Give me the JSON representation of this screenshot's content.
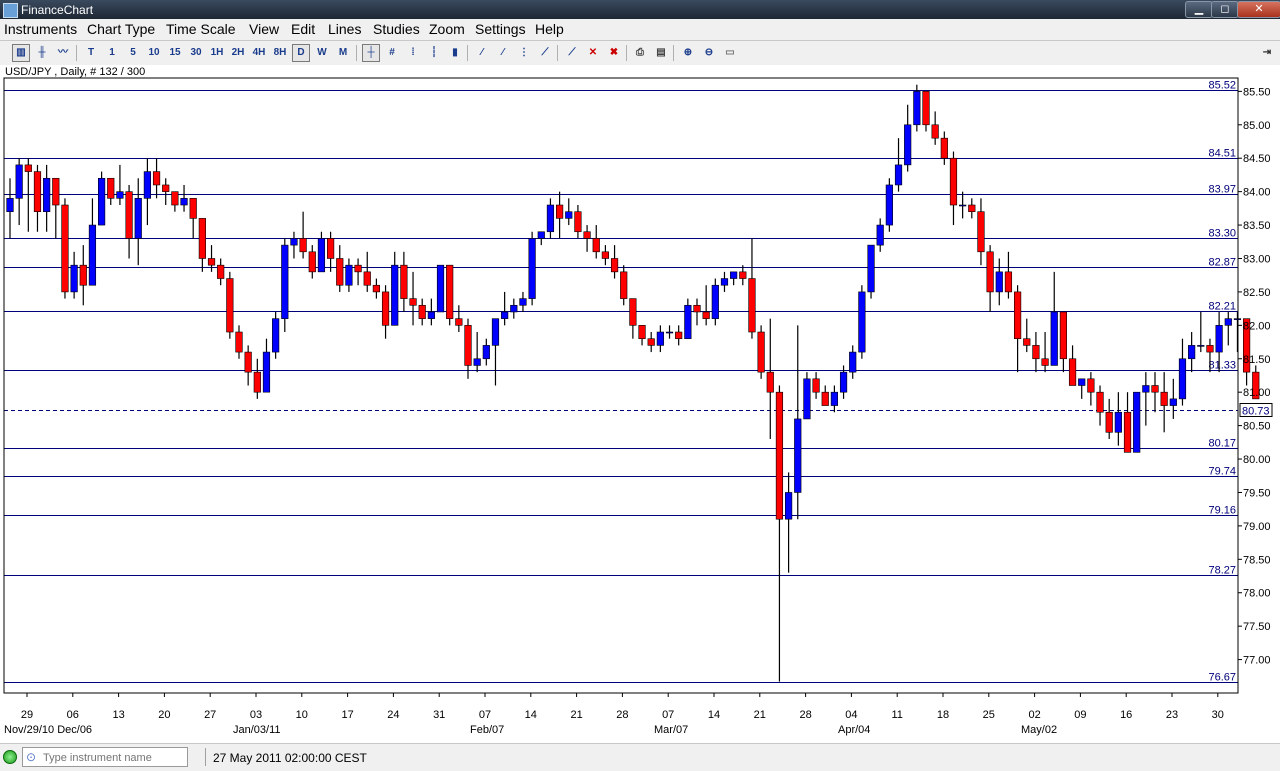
{
  "window": {
    "title": "FinanceChart",
    "minimize": "▁",
    "maximize": "◻",
    "close": "✕"
  },
  "menu": [
    "Instruments",
    "Chart Type",
    "Time Scale",
    "View",
    "Edit",
    "Lines",
    "Studies",
    "Zoom",
    "Settings",
    "Help"
  ],
  "toolbar": {
    "timeframes": [
      "T",
      "1",
      "5",
      "10",
      "15",
      "30",
      "1H",
      "2H",
      "4H",
      "8H",
      "D",
      "W",
      "M"
    ],
    "selected_timeframe": "D"
  },
  "chart_data": {
    "type": "candlestick",
    "title": "USD/JPY , Daily, # 132 / 300",
    "ylim": [
      76.5,
      85.7
    ],
    "y_ticks": [
      "85.50",
      "85.00",
      "84.50",
      "84.00",
      "83.50",
      "83.00",
      "82.50",
      "82.00",
      "81.50",
      "81.00",
      "80.50",
      "80.00",
      "79.50",
      "79.00",
      "78.50",
      "78.00",
      "77.50",
      "77.00"
    ],
    "x_ticks": [
      "29",
      "06",
      "13",
      "20",
      "27",
      "03",
      "10",
      "17",
      "24",
      "31",
      "07",
      "14",
      "21",
      "28",
      "07",
      "14",
      "21",
      "28",
      "04",
      "11",
      "18",
      "25",
      "02",
      "09",
      "16",
      "23",
      "30"
    ],
    "date_labels": [
      "Nov/29/10 Dec/06",
      "Jan/03/11",
      "Feb/07",
      "Mar/07",
      "Apr/04",
      "May/02"
    ],
    "horizontal_lines": [
      85.52,
      84.51,
      83.97,
      83.3,
      82.87,
      82.21,
      81.33,
      80.17,
      79.74,
      79.16,
      78.27,
      76.67
    ],
    "current_price": "80.73",
    "current_price_value": 80.73,
    "up_color": "#0000ff",
    "down_color": "#ff0000",
    "grid": false,
    "ohlc": [
      [
        83.7,
        84.2,
        83.3,
        83.9
      ],
      [
        83.9,
        84.5,
        83.5,
        84.4
      ],
      [
        84.4,
        84.5,
        83.4,
        84.3
      ],
      [
        84.3,
        84.4,
        83.4,
        83.7
      ],
      [
        83.7,
        84.4,
        83.4,
        84.2
      ],
      [
        84.2,
        84.2,
        83.3,
        83.8
      ],
      [
        83.8,
        83.9,
        82.4,
        82.5
      ],
      [
        82.5,
        83.1,
        82.4,
        82.9
      ],
      [
        82.9,
        83.2,
        82.3,
        82.6
      ],
      [
        82.6,
        83.9,
        82.6,
        83.5
      ],
      [
        83.5,
        84.3,
        83.5,
        84.2
      ],
      [
        84.2,
        84.2,
        83.8,
        83.9
      ],
      [
        83.9,
        84.4,
        83.8,
        84.0
      ],
      [
        84.0,
        84.1,
        83.0,
        83.3
      ],
      [
        83.3,
        84.2,
        82.9,
        83.9
      ],
      [
        83.9,
        84.5,
        83.5,
        84.3
      ],
      [
        84.3,
        84.5,
        83.9,
        84.1
      ],
      [
        84.1,
        84.2,
        83.8,
        84.0
      ],
      [
        84.0,
        84.0,
        83.7,
        83.8
      ],
      [
        83.8,
        84.1,
        83.7,
        83.9
      ],
      [
        83.9,
        83.9,
        83.3,
        83.6
      ],
      [
        83.6,
        83.6,
        82.8,
        83.0
      ],
      [
        83.0,
        83.2,
        82.8,
        82.9
      ],
      [
        82.9,
        83.0,
        82.6,
        82.7
      ],
      [
        82.7,
        82.8,
        81.8,
        81.9
      ],
      [
        81.9,
        82.0,
        81.5,
        81.6
      ],
      [
        81.6,
        81.7,
        81.1,
        81.3
      ],
      [
        81.3,
        81.5,
        80.9,
        81.0
      ],
      [
        81.0,
        81.8,
        81.0,
        81.6
      ],
      [
        81.6,
        82.2,
        81.5,
        82.1
      ],
      [
        82.1,
        83.3,
        81.9,
        83.2
      ],
      [
        83.2,
        83.4,
        83.0,
        83.3
      ],
      [
        83.3,
        83.7,
        83.0,
        83.1
      ],
      [
        83.1,
        83.2,
        82.7,
        82.8
      ],
      [
        82.8,
        83.4,
        82.8,
        83.3
      ],
      [
        83.3,
        83.4,
        82.8,
        83.0
      ],
      [
        83.0,
        83.2,
        82.5,
        82.6
      ],
      [
        82.6,
        83.0,
        82.5,
        82.9
      ],
      [
        82.9,
        83.0,
        82.6,
        82.8
      ],
      [
        82.8,
        83.1,
        82.5,
        82.6
      ],
      [
        82.6,
        82.7,
        82.4,
        82.5
      ],
      [
        82.5,
        82.6,
        81.8,
        82.0
      ],
      [
        82.0,
        83.1,
        82.0,
        82.9
      ],
      [
        82.9,
        83.1,
        82.2,
        82.4
      ],
      [
        82.4,
        82.8,
        82.0,
        82.3
      ],
      [
        82.3,
        82.4,
        82.0,
        82.1
      ],
      [
        82.1,
        82.4,
        82.0,
        82.2
      ],
      [
        82.2,
        82.9,
        82.2,
        82.9
      ],
      [
        82.9,
        82.9,
        82.0,
        82.1
      ],
      [
        82.1,
        82.3,
        81.9,
        82.0
      ],
      [
        82.0,
        82.1,
        81.2,
        81.4
      ],
      [
        81.4,
        81.9,
        81.3,
        81.5
      ],
      [
        81.5,
        81.8,
        81.4,
        81.7
      ],
      [
        81.7,
        82.1,
        81.1,
        82.1
      ],
      [
        82.1,
        82.5,
        82.0,
        82.2
      ],
      [
        82.2,
        82.4,
        82.1,
        82.3
      ],
      [
        82.3,
        82.5,
        82.2,
        82.4
      ],
      [
        82.4,
        83.4,
        82.3,
        83.3
      ],
      [
        83.3,
        83.4,
        83.2,
        83.4
      ],
      [
        83.4,
        83.9,
        83.3,
        83.8
      ],
      [
        83.8,
        84.0,
        83.3,
        83.6
      ],
      [
        83.6,
        83.9,
        83.5,
        83.7
      ],
      [
        83.7,
        83.8,
        83.3,
        83.4
      ],
      [
        83.4,
        83.5,
        83.1,
        83.3
      ],
      [
        83.3,
        83.5,
        83.0,
        83.1
      ],
      [
        83.1,
        83.2,
        82.9,
        83.0
      ],
      [
        83.0,
        83.2,
        82.7,
        82.8
      ],
      [
        82.8,
        82.9,
        82.3,
        82.4
      ],
      [
        82.4,
        82.4,
        81.8,
        82.0
      ],
      [
        82.0,
        82.0,
        81.7,
        81.8
      ],
      [
        81.8,
        81.9,
        81.6,
        81.7
      ],
      [
        81.7,
        82.0,
        81.6,
        81.9
      ],
      [
        81.9,
        82.0,
        81.8,
        81.9
      ],
      [
        81.9,
        82.0,
        81.7,
        81.8
      ],
      [
        81.8,
        82.4,
        81.8,
        82.3
      ],
      [
        82.3,
        82.4,
        82.0,
        82.2
      ],
      [
        82.2,
        82.6,
        82.0,
        82.1
      ],
      [
        82.1,
        82.7,
        82.0,
        82.6
      ],
      [
        82.6,
        82.8,
        82.5,
        82.7
      ],
      [
        82.7,
        82.8,
        82.6,
        82.8
      ],
      [
        82.8,
        82.9,
        82.6,
        82.7
      ],
      [
        82.7,
        83.3,
        81.8,
        81.9
      ],
      [
        81.9,
        82.0,
        81.2,
        81.3
      ],
      [
        81.3,
        82.1,
        80.3,
        81.0
      ],
      [
        81.0,
        81.1,
        76.67,
        79.1
      ],
      [
        79.1,
        79.8,
        78.3,
        79.5
      ],
      [
        79.5,
        82.0,
        79.1,
        80.6
      ],
      [
        80.6,
        81.3,
        80.6,
        81.2
      ],
      [
        81.2,
        81.3,
        80.9,
        81.0
      ],
      [
        81.0,
        81.1,
        80.8,
        80.8
      ],
      [
        80.8,
        81.1,
        80.7,
        81.0
      ],
      [
        81.0,
        81.4,
        80.9,
        81.3
      ],
      [
        81.3,
        81.7,
        81.2,
        81.6
      ],
      [
        81.6,
        82.6,
        81.5,
        82.5
      ],
      [
        82.5,
        83.2,
        82.4,
        83.2
      ],
      [
        83.2,
        83.6,
        83.1,
        83.5
      ],
      [
        83.5,
        84.2,
        83.4,
        84.1
      ],
      [
        84.1,
        84.8,
        84.0,
        84.4
      ],
      [
        84.4,
        85.3,
        84.3,
        85.0
      ],
      [
        85.0,
        85.6,
        84.9,
        85.5
      ],
      [
        85.5,
        85.5,
        84.9,
        85.0
      ],
      [
        85.0,
        85.2,
        84.7,
        84.8
      ],
      [
        84.8,
        84.9,
        84.4,
        84.5
      ],
      [
        84.5,
        84.6,
        83.5,
        83.8
      ],
      [
        83.8,
        84.0,
        83.6,
        83.8
      ],
      [
        83.8,
        83.9,
        83.6,
        83.7
      ],
      [
        83.7,
        83.9,
        82.9,
        83.1
      ],
      [
        83.1,
        83.2,
        82.2,
        82.5
      ],
      [
        82.5,
        83.0,
        82.3,
        82.8
      ],
      [
        82.8,
        83.1,
        82.4,
        82.5
      ],
      [
        82.5,
        82.6,
        81.3,
        81.8
      ],
      [
        81.8,
        82.1,
        81.6,
        81.7
      ],
      [
        81.7,
        81.9,
        81.3,
        81.5
      ],
      [
        81.5,
        81.9,
        81.3,
        81.4
      ],
      [
        81.4,
        82.8,
        81.4,
        82.2
      ],
      [
        82.2,
        82.2,
        81.3,
        81.5
      ],
      [
        81.5,
        81.7,
        81.1,
        81.1
      ],
      [
        81.1,
        81.2,
        80.9,
        81.2
      ],
      [
        81.2,
        81.3,
        80.8,
        81.0
      ],
      [
        81.0,
        81.1,
        80.5,
        80.7
      ],
      [
        80.7,
        80.9,
        80.3,
        80.4
      ],
      [
        80.4,
        81.0,
        80.2,
        80.7
      ],
      [
        80.7,
        81.0,
        80.1,
        80.1
      ],
      [
        80.1,
        81.0,
        80.1,
        81.0
      ],
      [
        81.0,
        81.3,
        80.5,
        81.1
      ],
      [
        81.1,
        81.3,
        80.7,
        81.0
      ],
      [
        81.0,
        81.3,
        80.4,
        80.8
      ],
      [
        80.8,
        81.2,
        80.6,
        80.9
      ],
      [
        80.9,
        81.8,
        80.8,
        81.5
      ],
      [
        81.5,
        81.9,
        81.3,
        81.7
      ],
      [
        81.7,
        82.2,
        81.6,
        81.7
      ],
      [
        81.7,
        81.8,
        81.3,
        81.6
      ],
      [
        81.6,
        82.2,
        81.3,
        82.0
      ],
      [
        82.0,
        82.2,
        81.7,
        82.1
      ],
      [
        82.1,
        82.2,
        81.6,
        82.1
      ],
      [
        82.1,
        82.1,
        81.1,
        81.3
      ],
      [
        81.3,
        81.4,
        80.9,
        80.9
      ]
    ]
  },
  "status": {
    "instrument_placeholder": "Type instrument name",
    "datetime": "27 May 2011 02:00:00 CEST"
  }
}
